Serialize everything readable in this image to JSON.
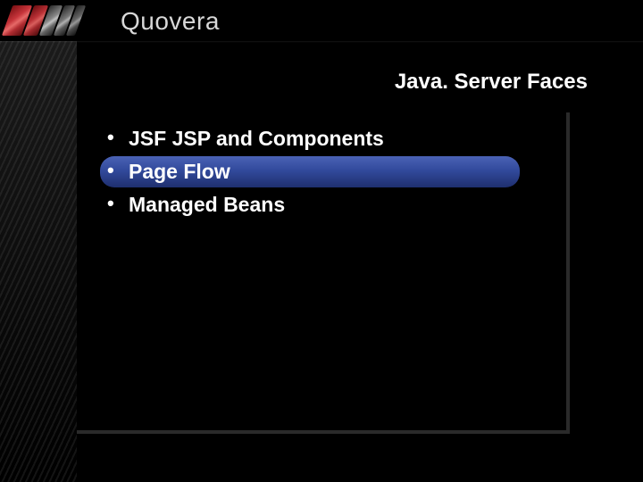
{
  "brand": "Quovera",
  "slide": {
    "title": "Java. Server Faces",
    "bullets": [
      {
        "text": "JSF JSP and Components",
        "highlighted": false
      },
      {
        "text": "Page Flow",
        "highlighted": true
      },
      {
        "text": "Managed Beans",
        "highlighted": false
      }
    ]
  }
}
